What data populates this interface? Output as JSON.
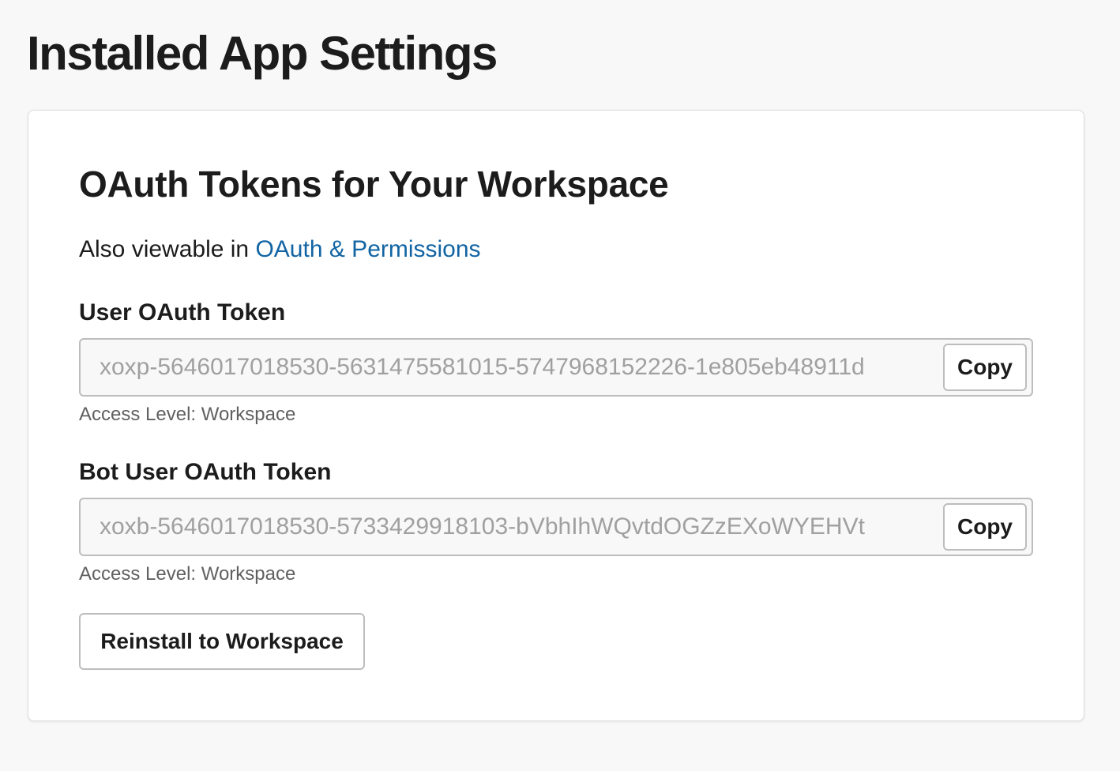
{
  "page": {
    "title": "Installed App Settings"
  },
  "oauth_section": {
    "title": "OAuth Tokens for Your Workspace",
    "subtext_prefix": "Also viewable in ",
    "subtext_link": "OAuth & Permissions",
    "link_color": "#1264a3"
  },
  "user_token": {
    "label": "User OAuth Token",
    "value": "xoxp-5646017018530-5631475581015-5747968152226-1e805eb48911d",
    "copy_label": "Copy",
    "access_level": "Access Level: Workspace"
  },
  "bot_token": {
    "label": "Bot User OAuth Token",
    "value": "xoxb-5646017018530-5733429918103-bVbhIhWQvtdOGZzEXoWYEHVt",
    "copy_label": "Copy",
    "access_level": "Access Level: Workspace"
  },
  "actions": {
    "reinstall_label": "Reinstall to Workspace"
  }
}
